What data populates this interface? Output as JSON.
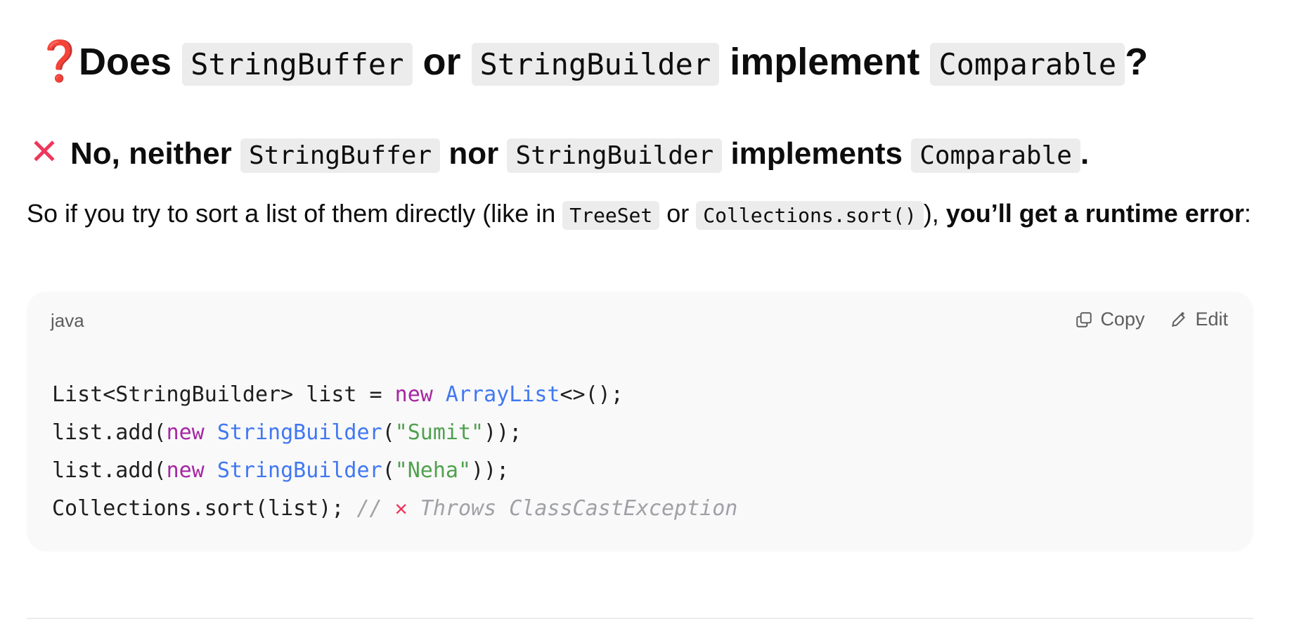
{
  "question": {
    "icon": "question-mark-icon",
    "icon_glyph": "❓",
    "parts": [
      "Does ",
      "StringBuffer",
      " or ",
      "StringBuilder",
      " implement ",
      "Comparable",
      "?"
    ]
  },
  "answer": {
    "icon": "cross-mark-icon",
    "icon_glyph": "✕",
    "parts": [
      "No, neither ",
      "StringBuffer",
      " nor ",
      "StringBuilder",
      " implements ",
      "Comparable",
      "."
    ]
  },
  "description": {
    "text1": "So if you try to sort a list of them directly (like in ",
    "code1": "TreeSet",
    "text2": " or ",
    "code2": "Collections.sort()",
    "text3": "), ",
    "bold": "you’ll get a runtime error",
    "text4": ":"
  },
  "code_block": {
    "language": "java",
    "copy_label": "Copy",
    "edit_label": "Edit",
    "lines": [
      [
        {
          "t": "List<StringBuilder> list = "
        },
        {
          "t": "new",
          "c": "kw"
        },
        {
          "t": " "
        },
        {
          "t": "ArrayList",
          "c": "ty"
        },
        {
          "t": "<>();"
        }
      ],
      [
        {
          "t": "list.add("
        },
        {
          "t": "new",
          "c": "kw"
        },
        {
          "t": " "
        },
        {
          "t": "StringBuilder",
          "c": "ty"
        },
        {
          "t": "("
        },
        {
          "t": "\"Sumit\"",
          "c": "st"
        },
        {
          "t": "));"
        }
      ],
      [
        {
          "t": "list.add("
        },
        {
          "t": "new",
          "c": "kw"
        },
        {
          "t": " "
        },
        {
          "t": "StringBuilder",
          "c": "ty"
        },
        {
          "t": "("
        },
        {
          "t": "\"Neha\"",
          "c": "st"
        },
        {
          "t": "));"
        }
      ],
      [
        {
          "t": "Collections.sort(list); "
        },
        {
          "t": "// ",
          "c": "cm"
        },
        {
          "t": "✕",
          "c": "cmx"
        },
        {
          "t": " Throws ClassCastException",
          "c": "cm"
        }
      ]
    ]
  }
}
